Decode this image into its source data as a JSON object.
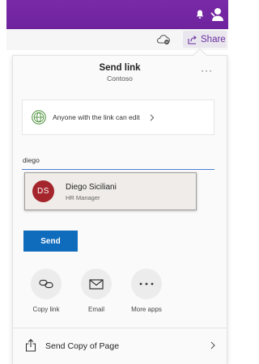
{
  "share_button": {
    "label": "Share"
  },
  "dialog": {
    "title": "Send link",
    "subtitle": "Contoso",
    "more_label": "···"
  },
  "permission": {
    "label": "Anyone with the link can edit"
  },
  "recipient_input": {
    "value": "diego"
  },
  "suggestion": {
    "initials": "DS",
    "name": "Diego Siciliani",
    "role": "HR Manager",
    "avatar_color": "#a4262c"
  },
  "send_button": {
    "label": "Send"
  },
  "apps": {
    "copy_link": {
      "label": "Copy link",
      "icon": "link-icon"
    },
    "email": {
      "label": "Email",
      "icon": "envelope-icon"
    },
    "more_apps": {
      "label": "More apps",
      "icon": "more-icon"
    }
  },
  "send_copy": {
    "label": "Send Copy of Page"
  },
  "colors": {
    "topbar": "#7a2aa8",
    "accent_blue": "#0f6cbd",
    "share_text": "#6b2fa0"
  }
}
